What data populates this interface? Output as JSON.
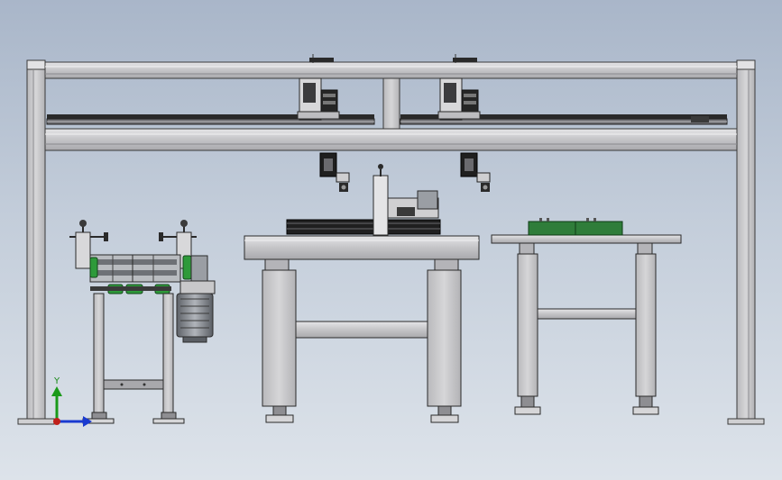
{
  "viewport": {
    "background_top": "#a9b6c9",
    "background_bottom": "#dde3ea"
  },
  "colors": {
    "frame_fill": "#c9c9cb",
    "frame_stroke": "#3a3a3a",
    "rail_dark": "#2a2a2a",
    "pcb_green": "#2f7d3a",
    "roller_green": "#2e9a3a",
    "motor_gray": "#8a8e94"
  },
  "triad": {
    "y_label": "Y",
    "x_label": "",
    "z_label": "",
    "y_color": "#1a9a1a",
    "x_color": "#c0201a",
    "z_color": "#1a3ad0"
  },
  "components": {
    "gantry_frame": "gantry-frame",
    "gantry_head_left": "gantry-head-left",
    "gantry_head_right": "gantry-head-right",
    "roller_machine": "roller-machine",
    "work_table_middle": "work-table-middle",
    "work_table_right": "work-table-right",
    "pcb_board": "pcb-board",
    "coordinate_triad": "coordinate-triad"
  }
}
